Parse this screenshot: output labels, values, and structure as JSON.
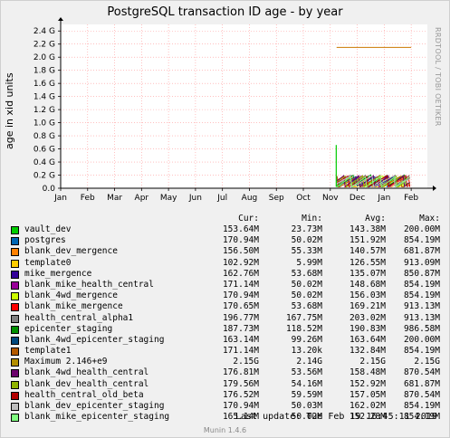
{
  "chart_data": {
    "type": "line",
    "title": "PostgreSQL transaction ID age - by year",
    "ylabel": "age in xid units",
    "ylim": [
      0,
      2.5
    ],
    "y_ticks": [
      "0.0",
      "0.2 G",
      "0.4 G",
      "0.6 G",
      "0.8 G",
      "1.0 G",
      "1.2 G",
      "1.4 G",
      "1.6 G",
      "1.8 G",
      "2.0 G",
      "2.2 G",
      "2.4 G"
    ],
    "x_ticks": [
      "Jan",
      "Feb",
      "Mar",
      "Apr",
      "May",
      "Jun",
      "Jul",
      "Aug",
      "Sep",
      "Oct",
      "Nov",
      "Dec",
      "Jan",
      "Feb"
    ],
    "x_range_months": [
      0,
      13.6
    ],
    "data_start_month": 10.2,
    "maximum_line": {
      "value_g": 2.15,
      "color": "#cc7700"
    },
    "spike": {
      "month": 10.22,
      "peak_g": 0.66
    },
    "side_label": "RRDTOOL / TOBI OETIKER"
  },
  "legend": {
    "headers": {
      "cur": "Cur:",
      "min": "Min:",
      "avg": "Avg:",
      "max": "Max:"
    },
    "rows": [
      {
        "name": "vault_dev",
        "color": "#00cc00",
        "cur": "153.64M",
        "min": "23.73M",
        "avg": "143.38M",
        "max": "200.00M"
      },
      {
        "name": "postgres",
        "color": "#0066b3",
        "cur": "170.94M",
        "min": "50.02M",
        "avg": "151.92M",
        "max": "854.19M"
      },
      {
        "name": "blank_dev_mergence",
        "color": "#ff8000",
        "cur": "156.50M",
        "min": "55.33M",
        "avg": "140.57M",
        "max": "681.87M"
      },
      {
        "name": "template0",
        "color": "#ffcc00",
        "cur": "102.92M",
        "min": "5.99M",
        "avg": "126.55M",
        "max": "913.09M"
      },
      {
        "name": "mike_mergence",
        "color": "#330099",
        "cur": "162.76M",
        "min": "53.68M",
        "avg": "135.07M",
        "max": "850.87M"
      },
      {
        "name": "blank_mike_health_central",
        "color": "#990099",
        "cur": "171.14M",
        "min": "50.02M",
        "avg": "148.68M",
        "max": "854.19M"
      },
      {
        "name": "blank_4wd_mergence",
        "color": "#ccff00",
        "cur": "170.94M",
        "min": "50.02M",
        "avg": "156.03M",
        "max": "854.19M"
      },
      {
        "name": "blank_mike_mergence",
        "color": "#ff0000",
        "cur": "170.65M",
        "min": "53.68M",
        "avg": "169.21M",
        "max": "913.13M"
      },
      {
        "name": "health_central_alpha1",
        "color": "#808080",
        "cur": "196.77M",
        "min": "167.75M",
        "avg": "203.02M",
        "max": "913.13M"
      },
      {
        "name": "epicenter_staging",
        "color": "#008f00",
        "cur": "187.73M",
        "min": "118.52M",
        "avg": "190.83M",
        "max": "986.58M"
      },
      {
        "name": "blank_4wd_epicenter_staging",
        "color": "#00487d",
        "cur": "163.14M",
        "min": "99.26M",
        "avg": "163.64M",
        "max": "200.00M"
      },
      {
        "name": "template1",
        "color": "#b35a00",
        "cur": "171.14M",
        "min": "13.20k",
        "avg": "132.84M",
        "max": "854.19M"
      },
      {
        "name": "Maximum 2.146+e9",
        "color": "#b38f00",
        "cur": "2.15G",
        "min": "2.14G",
        "avg": "2.15G",
        "max": "2.15G"
      },
      {
        "name": "blank_4wd_health_central",
        "color": "#6b006b",
        "cur": "176.81M",
        "min": "53.56M",
        "avg": "158.48M",
        "max": "870.54M"
      },
      {
        "name": "blank_dev_health_central",
        "color": "#8fb300",
        "cur": "179.56M",
        "min": "54.16M",
        "avg": "152.92M",
        "max": "681.87M"
      },
      {
        "name": "health_central_old_beta",
        "color": "#b30000",
        "cur": "176.52M",
        "min": "59.59M",
        "avg": "157.05M",
        "max": "870.54M"
      },
      {
        "name": "blank_dev_epicenter_staging",
        "color": "#bebebe",
        "cur": "170.94M",
        "min": "50.03M",
        "avg": "162.02M",
        "max": "854.19M"
      },
      {
        "name": "blank_mike_epicenter_staging",
        "color": "#80ff80",
        "cur": "165.14M",
        "min": "50.02M",
        "avg": "152.28M",
        "max": "854.19M"
      }
    ]
  },
  "footer": {
    "last_update": "Last update:  Tue Feb 19 16:45:11 2019",
    "munin": "Munin 1.4.6"
  }
}
